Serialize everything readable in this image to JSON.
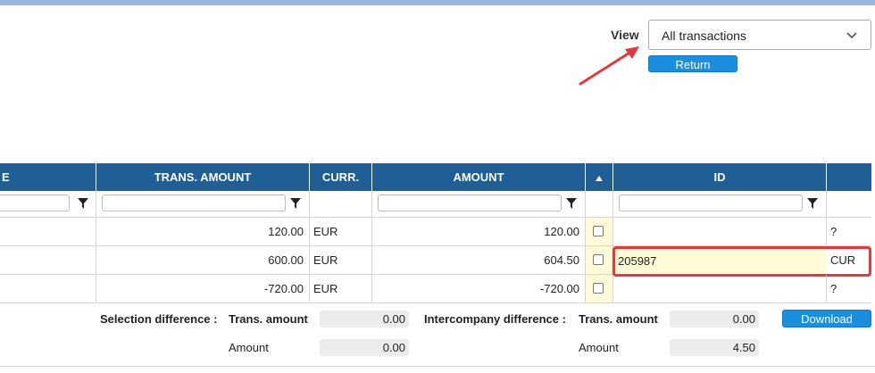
{
  "view": {
    "label": "View",
    "selected": "All transactions",
    "return_label": "Return"
  },
  "table": {
    "headers": {
      "col_e": "E",
      "trans_amount": "TRANS. AMOUNT",
      "curr": "CURR.",
      "amount": "AMOUNT",
      "id": "ID"
    },
    "rows": [
      {
        "trans_amount": "120.00",
        "curr": "EUR",
        "amount": "120.00",
        "id": "",
        "extra": "?"
      },
      {
        "trans_amount": "600.00",
        "curr": "EUR",
        "amount": "604.50",
        "id": "205987",
        "extra": "CUR"
      },
      {
        "trans_amount": "-720.00",
        "curr": "EUR",
        "amount": "-720.00",
        "id": "",
        "extra": "?"
      }
    ]
  },
  "footer": {
    "selection_label": "Selection difference :",
    "intercompany_label": "Intercompany difference :",
    "trans_amount_label": "Trans. amount",
    "amount_label": "Amount",
    "selection_trans_amount": "0.00",
    "selection_amount": "0.00",
    "intercompany_trans_amount": "0.00",
    "intercompany_amount": "4.50",
    "download_label": "Download"
  },
  "colors": {
    "header_bg": "#1f5f96",
    "button_bg": "#1a8fdd",
    "highlight": "#e0393e",
    "yellow": "#fffbd9"
  }
}
